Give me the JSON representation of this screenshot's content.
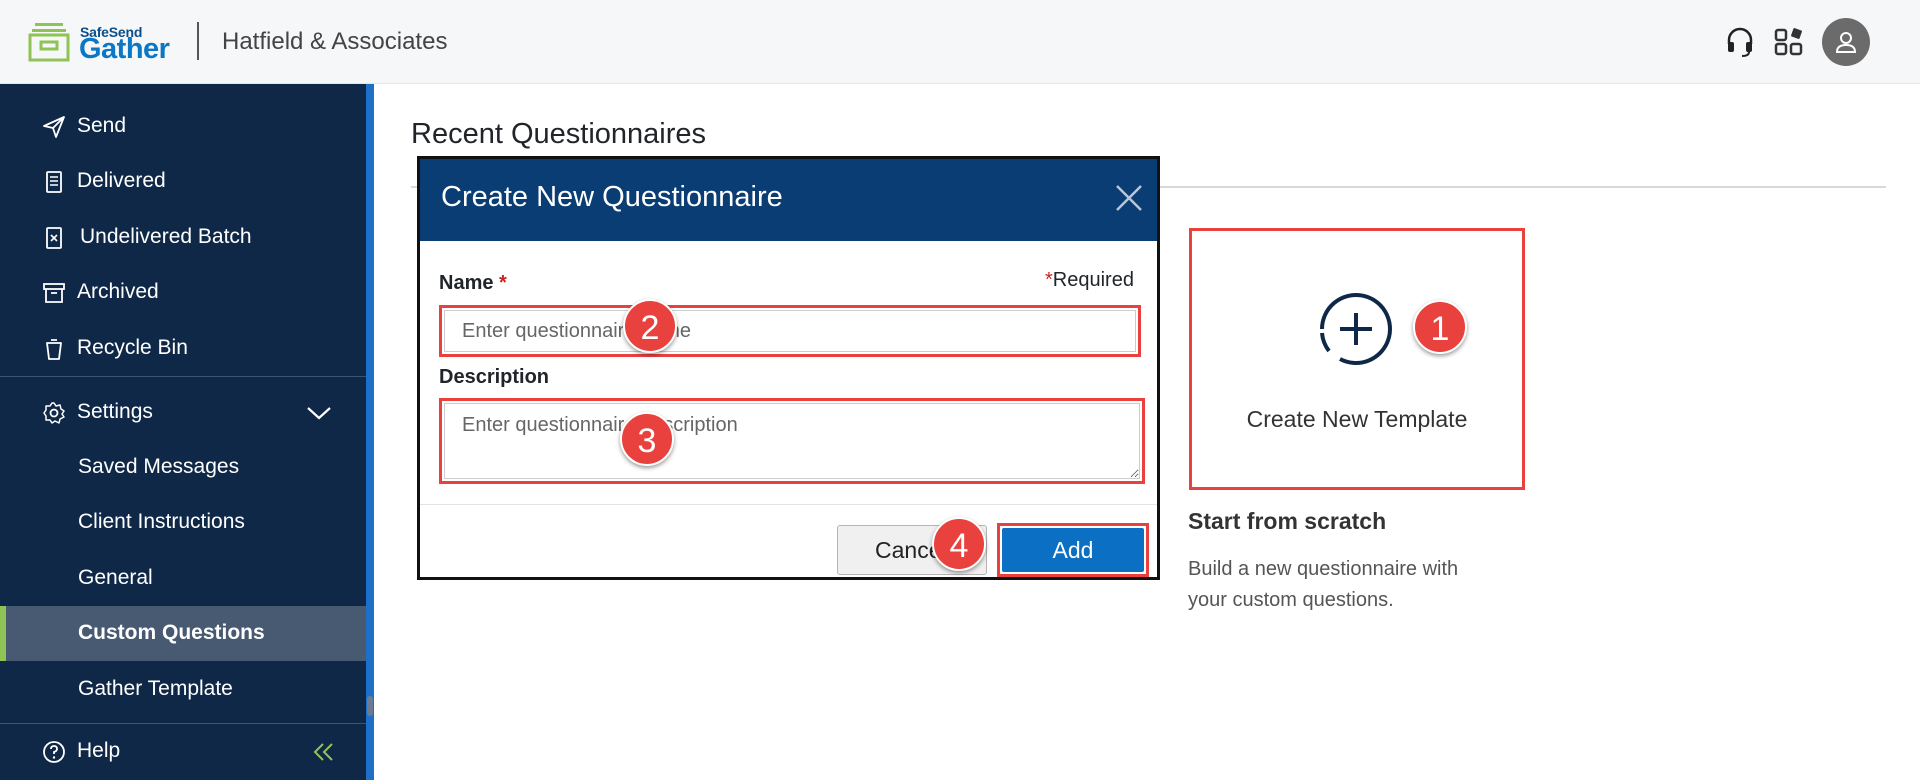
{
  "header": {
    "brand_small": "SafeSend",
    "brand_name": "Gather",
    "company": "Hatfield & Associates"
  },
  "sidebar": {
    "items": [
      {
        "label": "Send",
        "icon": "send-icon"
      },
      {
        "label": "Delivered",
        "icon": "document-icon"
      },
      {
        "label": "Undelivered Batch",
        "icon": "file-x-icon"
      },
      {
        "label": "Archived",
        "icon": "archive-icon"
      },
      {
        "label": "Recycle Bin",
        "icon": "trash-icon"
      }
    ],
    "settings": {
      "label": "Settings",
      "icon": "gear-icon",
      "expanded": true
    },
    "sub_items": [
      {
        "label": "Saved Messages",
        "active": false
      },
      {
        "label": "Client Instructions",
        "active": false
      },
      {
        "label": "General",
        "active": false
      },
      {
        "label": "Custom Questions",
        "active": true
      },
      {
        "label": "Gather Template",
        "active": false
      }
    ],
    "help": {
      "label": "Help",
      "icon": "help-icon"
    }
  },
  "main": {
    "title": "Recent Questionnaires",
    "template_card": {
      "label": "Create New Template"
    },
    "start_title": "Start from scratch",
    "start_desc": "Build a new questionnaire with your custom questions."
  },
  "modal": {
    "title": "Create New Questionnaire",
    "name_label": "Name",
    "required_star": "*",
    "required_note": "Required",
    "name_placeholder": "Enter questionnaire name",
    "desc_label": "Description",
    "desc_placeholder": "Enter questionnaire description",
    "cancel_label": "Cancel",
    "add_label": "Add"
  },
  "badges": [
    "1",
    "2",
    "3",
    "4"
  ],
  "colors": {
    "sidebar_bg": "#0f2847",
    "modal_header": "#0a3d73",
    "primary_button": "#0b6fc4",
    "highlight": "#e8413e",
    "active_accent": "#8fc355"
  }
}
